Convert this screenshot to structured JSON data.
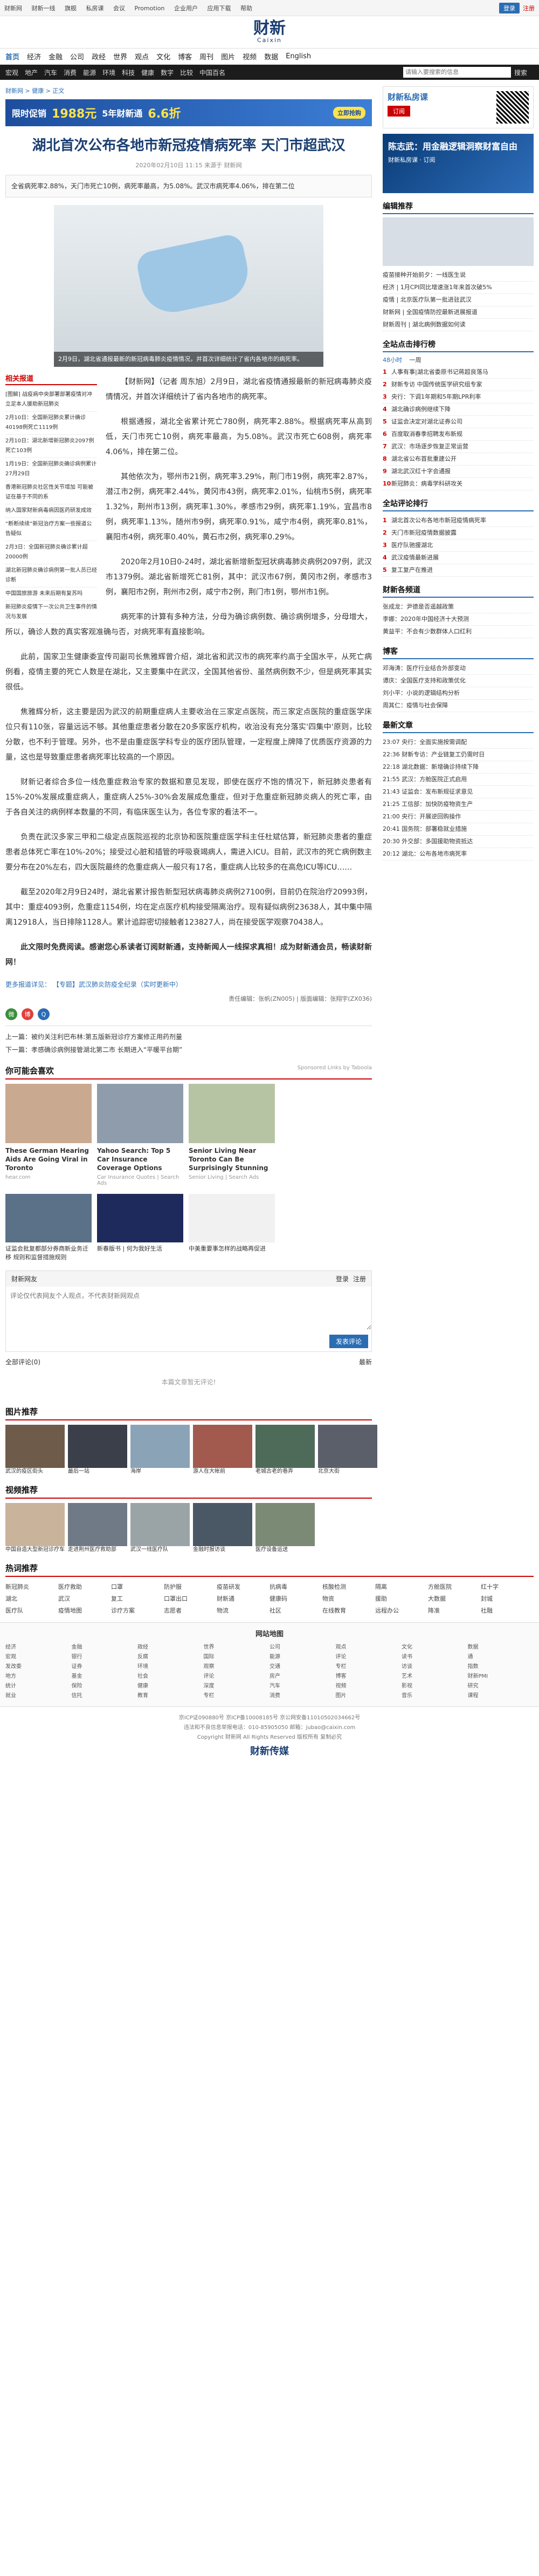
{
  "topbar": {
    "links": [
      "财新网",
      "财新一线",
      "旗舰",
      "私房课",
      "会议",
      "Promotion",
      "企业用户",
      "应用下载",
      "帮助"
    ],
    "login": "登录",
    "register": "注册"
  },
  "header": {
    "logo_cn": "财新",
    "logo_en": "Caixin",
    "right_links": [
      "文化",
      "博客",
      "周刊",
      "图片",
      "视频",
      "数据",
      "English"
    ]
  },
  "nav": {
    "items": [
      "首页",
      "经济",
      "金融",
      "公司",
      "政经",
      "世界",
      "观点",
      "文化",
      "博客",
      "周刊",
      "图片",
      "视频",
      "数据",
      "English"
    ]
  },
  "subnav": {
    "items": [
      "宏观",
      "地产",
      "汽车",
      "消费",
      "能源",
      "环境",
      "科技",
      "健康",
      "数字",
      "比较",
      "中国百名"
    ],
    "search_placeholder": "请输入要搜索的信息",
    "search_btn": "搜索"
  },
  "breadcrumb": "财新网 > 健康 > 正文",
  "promo": {
    "text": "限时促销",
    "price": "1988元",
    "text2": "5年财新通",
    "discount": "6.6折",
    "btn": "立即抢购"
  },
  "article": {
    "title": "湖北首次公布各地市新冠疫情病死率 天门市超武汉",
    "meta": "2020年02月10日 11:15 来源于 财新网",
    "summary": "全省病死率2.88%，天门市死亡10例，病死率最高，为5.08%。武汉市病死率4.06%，排在第二位",
    "caption": "2月9日，湖北省通报最新的新冠病毒肺炎疫情情况，并首次详细统计了省内各地市的病死率。",
    "paragraphs": [
      "【财新网】（记者 周东旭）2月9日，湖北省疫情通报最新的新冠病毒肺炎疫情情况，并首次详细统计了省内各地市的病死率。",
      "根据通报，湖北全省累计死亡780例，病死率2.88%。根据病死率从高到低，天门市死亡10例，病死率最高，为5.08%。武汉市死亡608例，病死率4.06%，排在第二位。",
      "其他依次为，鄂州市21例，病死率3.29%，荆门市19例，病死率2.87%，潜江市2例，病死率2.44%，黄冈市43例，病死率2.01%，仙桃市5例，病死率1.32%，荆州市13例，病死率1.30%，孝感市29例，病死率1.19%，宜昌市8例，病死率1.13%，随州市9例，病死率0.91%，咸宁市4例，病死率0.81%，襄阳市4例，病死率0.40%，黄石市2例，病死率0.29%。",
      "2020年2月10日0-24时，湖北省新增新型冠状病毒肺炎病例2097例，武汉市1379例。湖北省新增死亡81例，其中：武汉市67例，黄冈市2例，孝感市3例，襄阳市2例，荆州市2例，咸宁市2例，荆门市1例，鄂州市1例。",
      "病死率的计算有多种方法，分母为确诊病例数、确诊病例增多，分母增大，所以，确诊人数的真实客观准确与否，对病死率有直接影响。",
      "此前，国家卫生健康委宣传司副司长焦雅辉曾介绍，湖北省和武汉市的病死率约高于全国水平，从死亡病例看，疫情主要的死亡人数是在湖北，又主要集中在武汉，全国其他省份、虽然病例数不少，但是病死率其实很低。",
      "焦雅辉分析，这主要是因为武汉的前期重症病人主要收治在三家定点医院，而三家定点医院的重症医学床位只有110张，容量远远不够。其他重症患者分散在20多家医疗机构，收治没有充分落实'四集中'原则，比较分散，也不利于管理。另外，也不是由重症医学科专业的医疗团队管理，一定程度上牌降了优质医疗资源的力量，这也是导致重症患者病死率比较高的一个原因。",
      "财新记者综合多位一线危重症救治专家的数据和意见发现，即使在医疗不饱的情况下，新冠肺炎患者有15%-20%发展成重症病人，重症病人25%-30%会发展成危重症，但对于危重症新冠肺炎病人的死亡率，由于各自关注的病例样本数量的不同，有临床医生认为，各位专家的看法不一。",
      "负责在武汉多家三甲和二级定点医院巡视的北京协和医院重症医学科主任杜斌估算，新冠肺炎患者的重症患者总体死亡率在10%-20%；接受过心脏和插管的呼吸衰竭病人，需进入ICU。目前，武汉市的死亡病例数主要分布在20%左右，四大医院最终的危重症病人一般只有17名，重症病人比较多的在高危ICU等ICU……",
      "截至2020年2月9日24时，湖北省累计报告新型冠状病毒肺炎病例27100例，目前仍在院治疗20993例，其中：重症4093例，危重症1154例，均在定点医疗机构接受隔离治疗。现有疑似病例23638人，其中集中隔离12918人，当日排除1128人。累计追踪密切接触者123827人，尚在接受医学观察70438人。"
    ],
    "bold_line": "此文限时免费阅读。感谢您心系读者订阅财新通，支持新闻人一线探求真相！成为财新通会员，畅读财新网！",
    "related_links_label": "更多报道详见：",
    "related_links_text": "【专题】武汉肺炎防疫全纪录（实时更新中）",
    "editor": "责任编辑：张帆(ZN005) | 版面编辑：张翔宇(ZX036)",
    "prev": "上一篇：被约关注利巴布林:第五版新冠诊疗方案修正用药剂量",
    "next": "下一篇：孝感确诊病例接管湖北第二市 长期进入“平暖平台期”"
  },
  "related_news": {
    "title": "相关报道",
    "items": [
      "[图解] 战疫病中央部署部署疫情对冲立足本人援助新冠肺炎",
      "2月10日：全国新冠肺炎累计确诊40198例死亡1119例",
      "2月10日：湖北新增新冠肺炎2097例 死亡103例",
      "1月19日：全国新冠肺炎确诊病例累计27月29日",
      "香港新冠肺炎社区性关节增加 可能被证在基于不同的系",
      "纳入国家财新病毒病因医药研发成效",
      "“断断续续”新冠治疗方案一些报道公告疑似",
      "2月3日：全国新冠肺炎确诊累计超20000例",
      "湖北新冠肺炎确诊病例第一批人员已经诊断",
      "中国国旅旅游 未来后期有复苏吗",
      "新冠肺炎疫情下一次公共卫生事件的情况与发展"
    ]
  },
  "recommend": {
    "title": "你可能会喜欢",
    "sponsor": "Sponsored Links by Taboola",
    "cards": [
      {
        "t": "These German Hearing Aids Are Going Viral in Toronto",
        "s": "hear.com"
      },
      {
        "t": "Yahoo Search: Top 5 Car Insurance Coverage Options",
        "s": "Car Insurance Quotes | Search Ads"
      },
      {
        "t": "Senior Living Near Toronto Can Be Surprisingly Stunning",
        "s": "Senior Living | Search Ads"
      }
    ],
    "thumbs": [
      "证监会批复都部分券商新业务迁移 规则和监督措施规则",
      "新春版书 | 何为我好生活",
      "中美重要事怎样的战略再促进"
    ]
  },
  "comment": {
    "user": "财新网友",
    "login": "登录",
    "register": "注册",
    "placeholder": "评论仅代表网友个人观点，不代表财新网观点",
    "btn": "发表评论",
    "all_label": "全部评论(0)",
    "hot_label": "最新",
    "empty": "本篇文章暂无评论!"
  },
  "photos": {
    "title": "图片推荐",
    "items": [
      "武汉的疫区街头",
      "最后一站",
      "海岸",
      "游人在大帐前",
      "老城古老的巷弄",
      "北京大街",
      "全国各地援助医疗队"
    ]
  },
  "video": {
    "title": "视频推荐",
    "items": [
      "中国自造大型新冠诊疗车",
      "走进荆州医疗救助部",
      "武汉一线医疗队",
      "金融时报访谈",
      "医疗设备运送"
    ]
  },
  "hotwords": {
    "title": "热词推荐",
    "words": [
      "新冠肺炎",
      "医疗救助",
      "口罩",
      "防护服",
      "疫苗研发",
      "抗病毒",
      "核酸检测",
      "隔离",
      "方舱医院",
      "红十字",
      "湖北",
      "武汉",
      "复工",
      "口罩出口",
      "财新通",
      "健康码",
      "物资",
      "援助",
      "大数据",
      "封城",
      "医疗队",
      "疫情地图",
      "诊疗方案",
      "志愿者",
      "物流",
      "社区",
      "在线教育",
      "远程办公",
      "降准",
      "社融"
    ]
  },
  "sitemap": {
    "title": "网站地图",
    "cols": [
      [
        "经济",
        "宏观",
        "发改委",
        "地方",
        "统计",
        "就业"
      ],
      [
        "金融",
        "银行",
        "证券",
        "基金",
        "保险",
        "信托"
      ],
      [
        "政经",
        "反腐",
        "环境",
        "社会",
        "健康",
        "教育"
      ],
      [
        "世界",
        "国际",
        "观察",
        "评论",
        "深度",
        "专栏"
      ],
      [
        "公司",
        "能源",
        "交通",
        "房产",
        "汽车",
        "消费"
      ],
      [
        "观点",
        "评论",
        "专栏",
        "博客",
        "视频",
        "图片"
      ],
      [
        "文化",
        "读书",
        "访谈",
        "艺术",
        "影视",
        "音乐"
      ],
      [
        "数据",
        "通",
        "指数",
        "财新PMI",
        "研究",
        "课程"
      ]
    ]
  },
  "footer": {
    "lines": [
      "京ICP证090880号 京ICP备10008185号 京公网安备11010502034662号",
      "违法和不良信息举报电话：010-85905050 邮箱：jubao@caixin.com",
      "Copyright 财新网 All Rights Reserved 版权所有 复制必究"
    ],
    "brand": "财新传媒"
  },
  "side": {
    "ad_title": "财新私房课",
    "ad_btn": "订阅",
    "banner": {
      "title": "陈志武：用金融逻辑洞察财富自由",
      "sub": "财新私房课 · 订阅"
    },
    "recommend_title": "编辑推荐",
    "recommend": [
      "疫苗接种开始前夕：一线医生说",
      "经济 | 1月CPI同比增速涨1年来首次破5%",
      "疫情 | 北京医疗队第一批进驻武汉",
      "财新网 | 全国疫情防控最新进展报道",
      "财新周刊 | 湖北病例数据如何读"
    ],
    "hot_title": "全站点击排行榜",
    "hot_tabs": [
      "48小时",
      "一周"
    ],
    "hot": [
      "人事有事|湖北省委原书记蒋超良落马",
      "财新专访 中国传统医学研究组专家",
      "央行：下调1年期和5年期LPR利率",
      "湖北确诊病例继续下降",
      "证监会决定对湖北证券公司",
      "百度取消春季招聘发布新规",
      "武汉：市场逐步恢复正常运营",
      "湖北省公布首批重建公开",
      "湖北武汉红十字会通报",
      "新冠肺炎：病毒学科研攻关"
    ],
    "comment_rank_title": "全站评论排行",
    "comment_rank": [
      "湖北首次公布各地市新冠疫情病死率",
      "天门市新冠疫情数据披露",
      "医疗队驰援湖北",
      "武汉疫情最新进展",
      "复工复产在推进"
    ],
    "news_title": "财新各频道",
    "news": [
      "张成龙：尹德是否遥越政策",
      "李娜：2020年中国经济十大预测",
      "黄益平：不会有少数群体人口红利"
    ],
    "blog_title": "博客",
    "blog": [
      "邓海涛：医疗行业结合外部变动",
      "谭庆：全国医疗支持和政策优化",
      "刘小平：小说的逻辑结构分析",
      "周其仁：疫情与社会保障"
    ],
    "latest_title": "最新文章",
    "latest": [
      "23:07 央行：全面实施按需调配",
      "22:36 财新专访：产业链复工仍需时日",
      "22:18 湖北数据：新增确诊持续下降",
      "21:55 武汉：方舱医院正式启用",
      "21:43 证监会：发布新规征求意见",
      "21:25 工信部：加快防疫物资生产",
      "21:00 央行：开展逆回购操作",
      "20:41 国务院：部署稳就业措施",
      "20:30 外交部：多国援助物资抵达",
      "20:12 湖北：公布各地市病死率"
    ]
  }
}
